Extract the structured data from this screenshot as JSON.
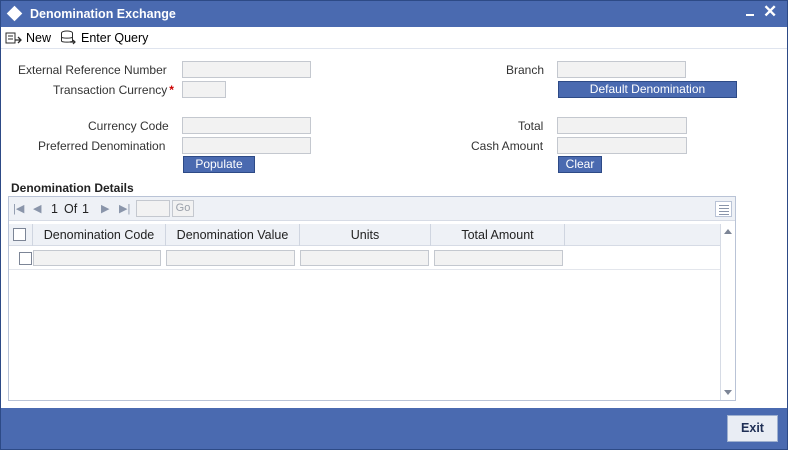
{
  "window": {
    "title": "Denomination Exchange",
    "icon": "diamond-icon",
    "controls": {
      "minimize": "minimize-icon",
      "close": "close-icon"
    }
  },
  "toolbar": {
    "new_label": "New",
    "enter_query_label": "Enter Query"
  },
  "form": {
    "external_reference_number": {
      "label": "External Reference Number",
      "value": ""
    },
    "transaction_currency": {
      "label": "Transaction Currency",
      "required_marker": "*",
      "value": ""
    },
    "branch": {
      "label": "Branch",
      "value": ""
    },
    "default_denomination_label": "Default Denomination",
    "currency_code": {
      "label": "Currency Code",
      "value": ""
    },
    "preferred_denomination": {
      "label": "Preferred Denomination",
      "value": ""
    },
    "total": {
      "label": "Total",
      "value": ""
    },
    "cash_amount": {
      "label": "Cash Amount",
      "value": ""
    },
    "populate_label": "Populate",
    "clear_label": "Clear"
  },
  "details": {
    "section_title": "Denomination Details",
    "pager": {
      "current": "1",
      "of_label": "Of",
      "total": "1",
      "go_label": "Go"
    },
    "columns": [
      "Denomination Code",
      "Denomination Value",
      "Units",
      "Total Amount"
    ],
    "rows": [
      {
        "denomination_code": "",
        "denomination_value": "",
        "units": "",
        "total_amount": ""
      }
    ]
  },
  "footer": {
    "exit_label": "Exit"
  },
  "colors": {
    "title_bar": "#4a6ab0",
    "button_blue": "#4a6ab0",
    "required": "#cc0000"
  }
}
